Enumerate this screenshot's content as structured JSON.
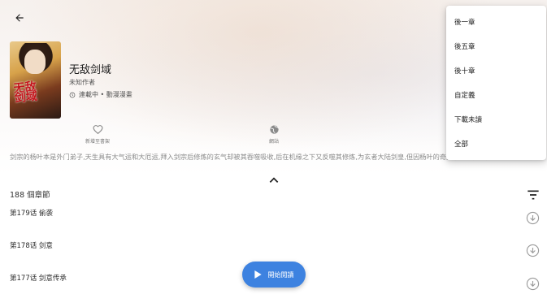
{
  "manga": {
    "title": "无敌剑域",
    "author": "未知作者",
    "status": "連載中 • 動漫漫畫",
    "cover_text": "无敌剑域"
  },
  "actions": {
    "favorite_label": "新增至書架",
    "webview_label": "網站"
  },
  "description": "剑宗的杨叶本是外门弟子,天生具有大气运和大厄运,拜入剑宗后修炼的玄气却被其吞噬吸收,后在机缘之下又反噬其修炼,为玄者大陆剑皇,但因杨叶的奇异功法...角的身体一路护满,助他成长,最终主角依靠毅力、和一颗强者心、逆天而行、不敢大热、踏上一条属于自己的证道大路....",
  "chapters": {
    "count_label": "188 個章節",
    "items": [
      {
        "name": "第179话 偷袭"
      },
      {
        "name": "第178话 剑意"
      },
      {
        "name": "第177话 剑意传承"
      }
    ]
  },
  "fab": {
    "label": "開始閱讀"
  },
  "menu": {
    "items": [
      {
        "label": "後一章"
      },
      {
        "label": "後五章"
      },
      {
        "label": "後十章"
      },
      {
        "label": "自定義"
      },
      {
        "label": "下載未讀"
      },
      {
        "label": "全部"
      }
    ]
  },
  "colors": {
    "accent": "#3d82e0",
    "icon_gray": "#8a8a8a"
  }
}
